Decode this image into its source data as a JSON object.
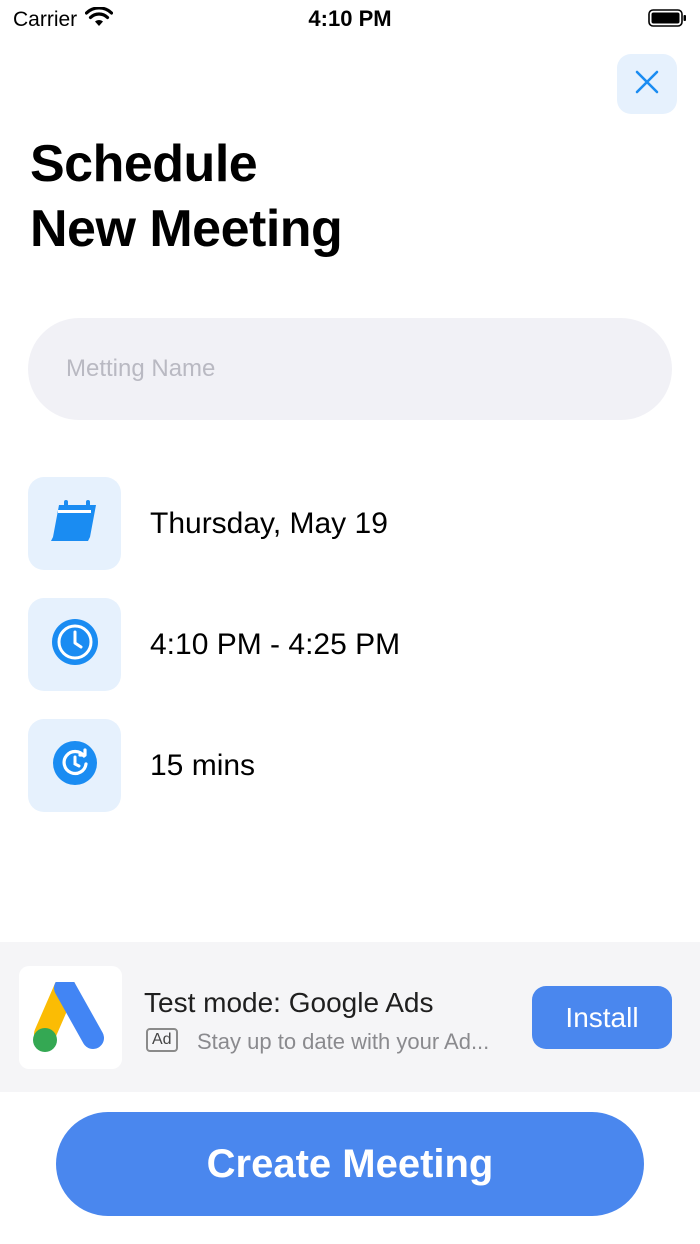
{
  "status_bar": {
    "carrier": "Carrier",
    "time": "4:10 PM",
    "wifi_icon": "wifi-icon",
    "battery_icon": "battery-icon"
  },
  "header": {
    "close_icon": "close-icon",
    "title_line1": "Schedule",
    "title_line2": "New Meeting"
  },
  "form": {
    "meeting_name_placeholder": "Metting Name",
    "meeting_name_value": ""
  },
  "details": {
    "date": {
      "icon": "calendar-icon",
      "text": "Thursday, May 19"
    },
    "time_range": {
      "icon": "clock-icon",
      "text": "4:10 PM - 4:25 PM"
    },
    "duration": {
      "icon": "timer-icon",
      "text": "15 mins"
    }
  },
  "ad": {
    "logo_icon": "google-ads-logo",
    "title": "Test mode: Google Ads",
    "badge": "Ad",
    "description": "Stay up to date with your Ad...",
    "install_label": "Install"
  },
  "footer": {
    "create_label": "Create Meeting"
  },
  "colors": {
    "accent": "#4a87ee",
    "icon_blue": "#1a8cf2",
    "icon_bg": "#e6f1fd",
    "input_bg": "#f1f1f6",
    "ad_bg": "#f5f5f7"
  }
}
